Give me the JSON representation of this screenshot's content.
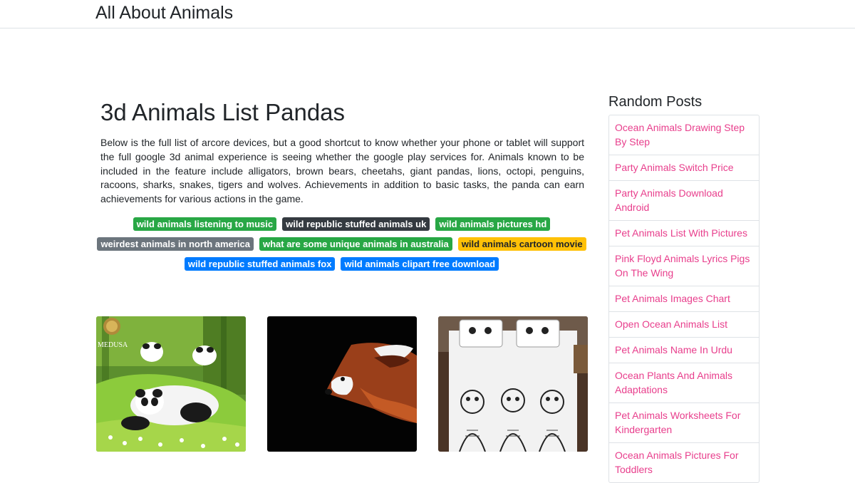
{
  "site": {
    "brand": "All About Animals"
  },
  "article": {
    "title": "3d Animals List Pandas",
    "description": "Below is the full list of arcore devices, but a good shortcut to know whether your phone or tablet will support the full google 3d animal experience is seeing whether the google play services for. Animals known to be included in the feature include alligators, brown bears, cheetahs, giant pandas, lions, octopi, penguins, racoons, sharks, snakes, tigers and wolves. Achievements in addition to basic tasks, the panda can earn achievements for various actions in the game."
  },
  "tags": [
    {
      "label": "wild animals listening to music",
      "color": "#28a745"
    },
    {
      "label": "wild republic stuffed animals uk",
      "color": "#343a40"
    },
    {
      "label": "wild animals pictures hd",
      "color": "#28a745"
    },
    {
      "label": "weirdest animals in north america",
      "color": "#6c757d"
    },
    {
      "label": "what are some unique animals in australia",
      "color": "#28a745"
    },
    {
      "label": "wild animals cartoon movie",
      "color": "#ffc107"
    },
    {
      "label": "wild republic stuffed animals fox",
      "color": "#007bff"
    },
    {
      "label": "wild animals clipart free download",
      "color": "#007bff"
    }
  ],
  "thumbnails": [
    {
      "subject": "panda bedding set",
      "logo_text": "MEDUSA"
    },
    {
      "subject": "red panda on black background"
    },
    {
      "subject": "sketch animals bedding set"
    }
  ],
  "sidebar": {
    "title": "Random Posts",
    "items": [
      "Ocean Animals Drawing Step By Step",
      "Party Animals Switch Price",
      "Party Animals Download Android",
      "Pet Animals List With Pictures",
      "Pink Floyd Animals Lyrics Pigs On The Wing",
      "Pet Animals Images Chart",
      "Open Ocean Animals List",
      "Pet Animals Name In Urdu",
      "Ocean Plants And Animals Adaptations",
      "Pet Animals Worksheets For Kindergarten",
      "Ocean Animals Pictures For Toddlers"
    ]
  },
  "colors": {
    "link": "#e83e8c",
    "border": "#dee2e6",
    "text": "#212529"
  }
}
